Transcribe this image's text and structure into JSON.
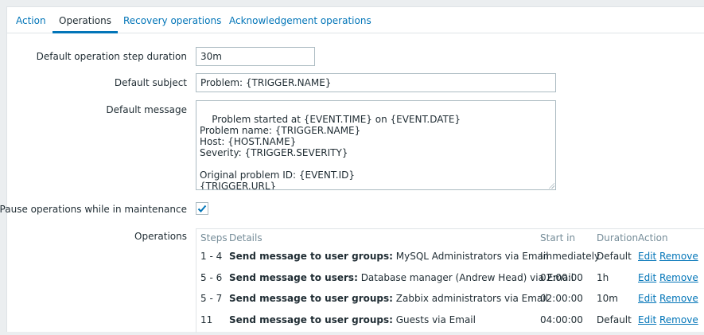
{
  "tabs": [
    {
      "label": "Action"
    },
    {
      "label": "Operations"
    },
    {
      "label": "Recovery operations"
    },
    {
      "label": "Acknowledgement operations"
    }
  ],
  "form": {
    "step_duration": {
      "label": "Default operation step duration",
      "value": "30m"
    },
    "subject": {
      "label": "Default subject",
      "value": "Problem: {TRIGGER.NAME}"
    },
    "message": {
      "label": "Default message",
      "value": "Problem started at {EVENT.TIME} on {EVENT.DATE}\nProblem name: {TRIGGER.NAME}\nHost: {HOST.NAME}\nSeverity: {TRIGGER.SEVERITY}\n\nOriginal problem ID: {EVENT.ID}\n{TRIGGER.URL}"
    },
    "pause": {
      "label": "Pause operations while in maintenance",
      "checked": true
    },
    "operations_label": "Operations"
  },
  "operations": {
    "headers": {
      "steps": "Steps",
      "details": "Details",
      "start_in": "Start in",
      "duration": "Duration",
      "action": "Action"
    },
    "rows": [
      {
        "steps": "1 - 4",
        "detail_bold": "Send message to user groups:",
        "detail_rest": " MySQL Administrators via Email",
        "start_in": "Immediately",
        "duration": "Default",
        "edit": "Edit",
        "remove": "Remove"
      },
      {
        "steps": "5 - 6",
        "detail_bold": "Send message to users:",
        "detail_rest": " Database manager (Andrew Head) via Email",
        "start_in": "02:00:00",
        "duration": "1h",
        "edit": "Edit",
        "remove": "Remove"
      },
      {
        "steps": "5 - 7",
        "detail_bold": "Send message to user groups:",
        "detail_rest": " Zabbix administrators via Email",
        "start_in": "02:00:00",
        "duration": "10m",
        "edit": "Edit",
        "remove": "Remove"
      },
      {
        "steps": "11",
        "detail_bold": "Send message to user groups:",
        "detail_rest": " Guests via Email",
        "start_in": "04:00:00",
        "duration": "Default",
        "edit": "Edit",
        "remove": "Remove"
      }
    ]
  },
  "colors": {
    "link": "#0275b8",
    "active_tab_underline": "#0275b8",
    "text": "#1f2c33",
    "muted": "#768d99",
    "border": "#acbbc2"
  }
}
